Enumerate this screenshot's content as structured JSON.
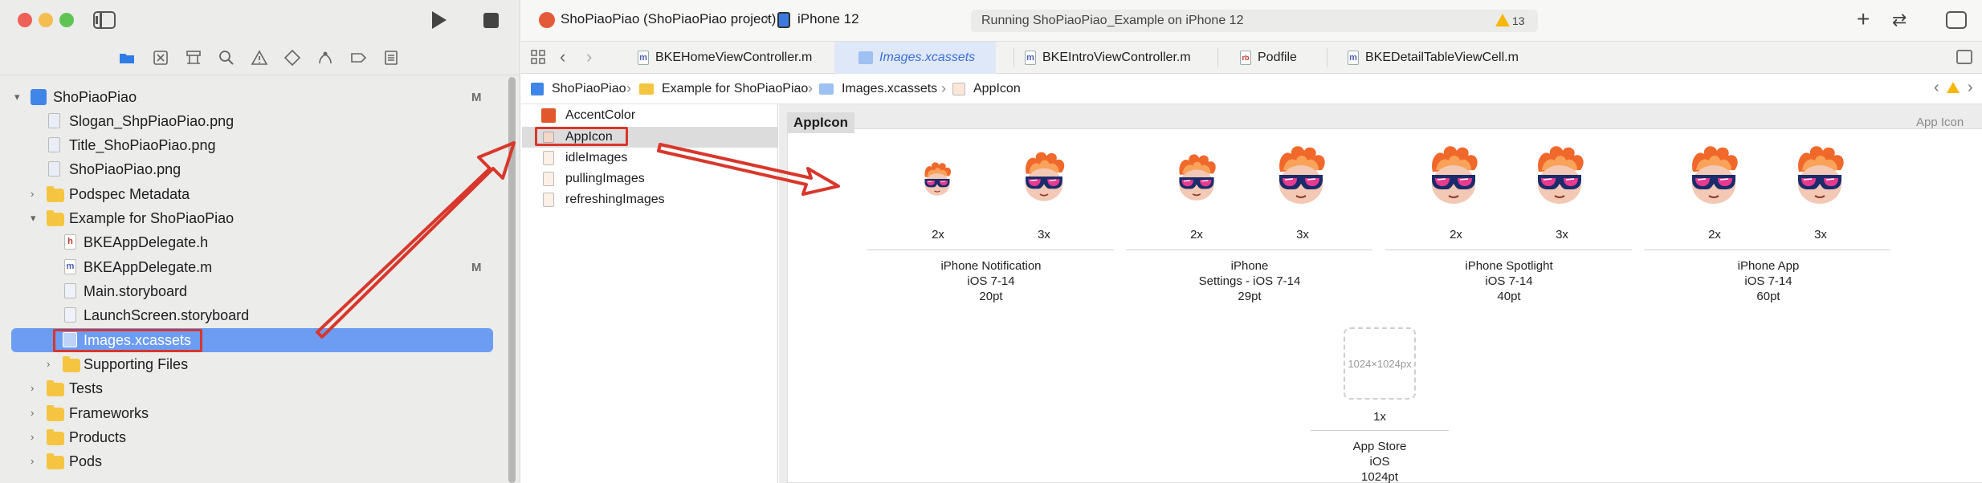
{
  "window": {
    "title": "ShoPiaoPiao (ShoPiaoPiao project)",
    "device": "iPhone 12",
    "status": "Running ShoPiaoPiao_Example on iPhone 12",
    "warnings": "13"
  },
  "navigator": {
    "root": {
      "label": "ShoPiaoPiao",
      "badge": "M"
    },
    "items": [
      {
        "label": "Slogan_ShpPiaoPiao.png",
        "kind": "image"
      },
      {
        "label": "Title_ShoPiaoPiao.png",
        "kind": "image"
      },
      {
        "label": "ShoPiaoPiao.png",
        "kind": "image"
      },
      {
        "label": "Podspec Metadata",
        "kind": "folder"
      },
      {
        "label": "Example for ShoPiaoPiao",
        "kind": "folder"
      },
      {
        "label": "BKEAppDelegate.h",
        "kind": "header",
        "glyph": "h"
      },
      {
        "label": "BKEAppDelegate.m",
        "kind": "source",
        "glyph": "m",
        "badge": "M"
      },
      {
        "label": "Main.storyboard",
        "kind": "storyboard"
      },
      {
        "label": "LaunchScreen.storyboard",
        "kind": "storyboard"
      },
      {
        "label": "Images.xcassets",
        "kind": "assets"
      },
      {
        "label": "Supporting Files",
        "kind": "folder"
      },
      {
        "label": "Tests",
        "kind": "folder"
      },
      {
        "label": "Frameworks",
        "kind": "folder"
      },
      {
        "label": "Products",
        "kind": "folder"
      },
      {
        "label": "Pods",
        "kind": "folder"
      }
    ]
  },
  "tabs": [
    {
      "label": "BKEHomeViewController.m",
      "glyph": "m"
    },
    {
      "label": "Images.xcassets",
      "glyph": ""
    },
    {
      "label": "BKEIntroViewController.m",
      "glyph": "m"
    },
    {
      "label": "Podfile",
      "glyph": "rb"
    },
    {
      "label": "BKEDetailTableViewCell.m",
      "glyph": "m"
    }
  ],
  "breadcrumb": [
    "ShoPiaoPiao",
    "Example for ShoPiaoPiao",
    "Images.xcassets",
    "AppIcon"
  ],
  "assets": [
    "AccentColor",
    "AppIcon",
    "idleImages",
    "pullingImages",
    "refreshingImages"
  ],
  "canvas": {
    "title": "AppIcon",
    "type_label": "App Icon",
    "groups": [
      {
        "slots": [
          "2x",
          "3x"
        ],
        "lines": [
          "iPhone Notification",
          "iOS 7-14",
          "20pt"
        ]
      },
      {
        "slots": [
          "2x",
          "3x"
        ],
        "lines": [
          "iPhone",
          "Settings - iOS 7-14",
          "29pt"
        ]
      },
      {
        "slots": [
          "2x",
          "3x"
        ],
        "lines": [
          "iPhone Spotlight",
          "iOS 7-14",
          "40pt"
        ]
      },
      {
        "slots": [
          "2x",
          "3x"
        ],
        "lines": [
          "iPhone App",
          "iOS 7-14",
          "60pt"
        ]
      }
    ],
    "store": {
      "placeholder": "1024×1024px",
      "slot": "1x",
      "lines": [
        "App Store",
        "iOS",
        "1024pt"
      ]
    }
  },
  "colors": {
    "accent": "#3a6fd8",
    "selection": "#6c9df2",
    "annotation": "#d8372c",
    "folder": "#f5c542"
  }
}
